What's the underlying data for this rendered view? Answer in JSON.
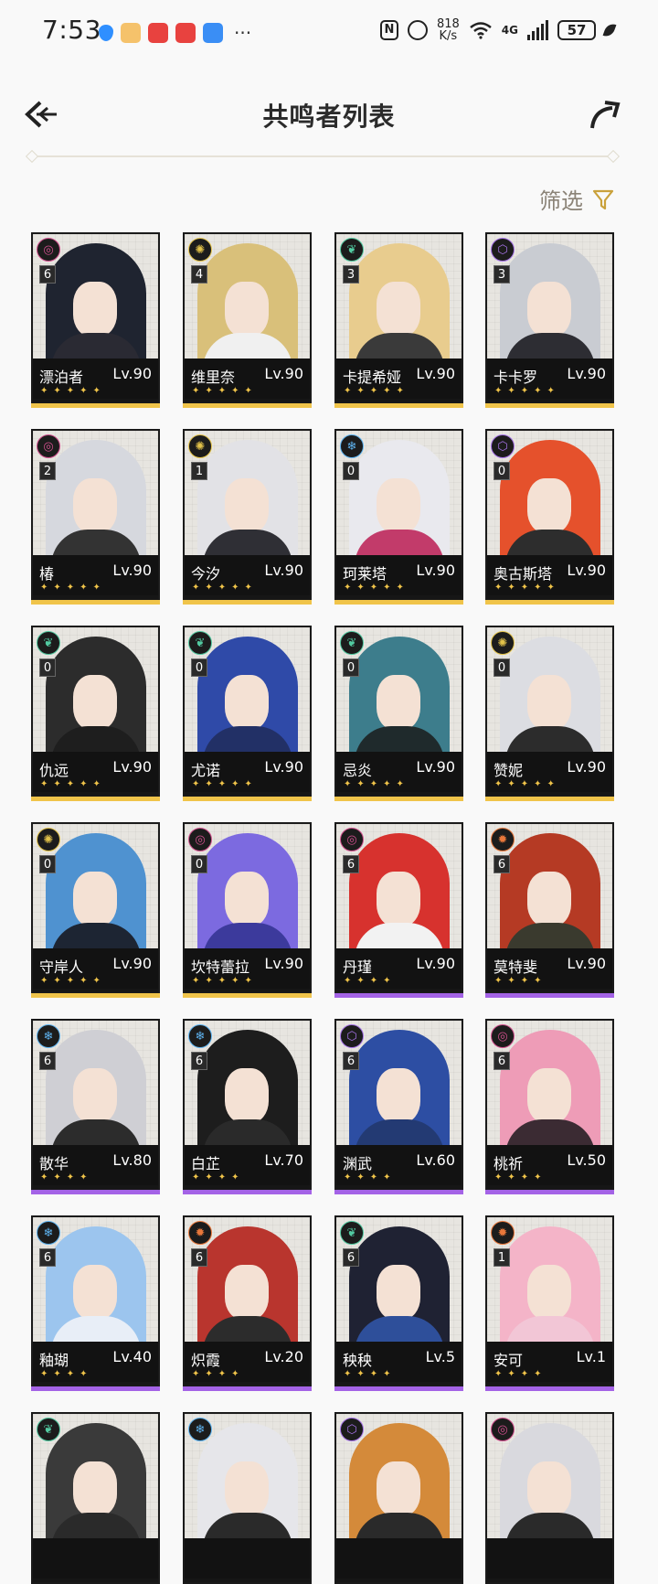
{
  "status_bar": {
    "time": "7:53",
    "net_speed_top": "818",
    "net_speed_bottom": "K/s",
    "battery": "57",
    "net_type": "4G",
    "nfc": "N"
  },
  "header": {
    "title": "共鸣者列表"
  },
  "filter": {
    "label": "筛选"
  },
  "colors": {
    "gold": "#f0c44a",
    "purple": "#a463e6",
    "title": "#2b2b2b",
    "filter": "#8b8377"
  },
  "characters": [
    {
      "name": "漂泊者",
      "level": "Lv.90",
      "rank": "6",
      "stars": 5,
      "element": "havoc",
      "hair": "#1f2430",
      "outfit": "#2a2a33"
    },
    {
      "name": "维里奈",
      "level": "Lv.90",
      "rank": "4",
      "stars": 5,
      "element": "spectro",
      "hair": "#d9c07a",
      "outfit": "#f0f0f0"
    },
    {
      "name": "卡提希娅",
      "level": "Lv.90",
      "rank": "3",
      "stars": 5,
      "element": "aero",
      "hair": "#e8cc8e",
      "outfit": "#3a3a3a"
    },
    {
      "name": "卡卡罗",
      "level": "Lv.90",
      "rank": "3",
      "stars": 5,
      "element": "electro",
      "hair": "#c9ccd2",
      "outfit": "#2d2d33"
    },
    {
      "name": "椿",
      "level": "Lv.90",
      "rank": "2",
      "stars": 5,
      "element": "havoc",
      "hair": "#d6d8de",
      "outfit": "#333"
    },
    {
      "name": "今汐",
      "level": "Lv.90",
      "rank": "1",
      "stars": 5,
      "element": "spectro",
      "hair": "#e2e2e6",
      "outfit": "#2f2f35"
    },
    {
      "name": "珂莱塔",
      "level": "Lv.90",
      "rank": "0",
      "stars": 5,
      "element": "glacio",
      "hair": "#e9e9ee",
      "outfit": "#c23b6a"
    },
    {
      "name": "奥古斯塔",
      "level": "Lv.90",
      "rank": "0",
      "stars": 5,
      "element": "electro",
      "hair": "#e5512c",
      "outfit": "#2d2d2d"
    },
    {
      "name": "仇远",
      "level": "Lv.90",
      "rank": "0",
      "stars": 5,
      "element": "aero",
      "hair": "#2c2c2c",
      "outfit": "#1e1e1e"
    },
    {
      "name": "尤诺",
      "level": "Lv.90",
      "rank": "0",
      "stars": 5,
      "element": "aero",
      "hair": "#2f4aa8",
      "outfit": "#223066"
    },
    {
      "name": "忌炎",
      "level": "Lv.90",
      "rank": "0",
      "stars": 5,
      "element": "aero",
      "hair": "#3d7d8c",
      "outfit": "#1f2a2c"
    },
    {
      "name": "赞妮",
      "level": "Lv.90",
      "rank": "0",
      "stars": 5,
      "element": "spectro",
      "hair": "#dcdde2",
      "outfit": "#2c2c2c"
    },
    {
      "name": "守岸人",
      "level": "Lv.90",
      "rank": "0",
      "stars": 5,
      "element": "spectro",
      "hair": "#4f92d0",
      "outfit": "#1d2533"
    },
    {
      "name": "坎特蕾拉",
      "level": "Lv.90",
      "rank": "0",
      "stars": 5,
      "element": "havoc",
      "hair": "#7c6ae0",
      "outfit": "#3c3a9c"
    },
    {
      "name": "丹瑾",
      "level": "Lv.90",
      "rank": "6",
      "stars": 4,
      "element": "havoc",
      "hair": "#d7322e",
      "outfit": "#f2f2f2"
    },
    {
      "name": "莫特斐",
      "level": "Lv.90",
      "rank": "6",
      "stars": 4,
      "element": "fusion",
      "hair": "#b53a24",
      "outfit": "#3a3a2e"
    },
    {
      "name": "散华",
      "level": "Lv.80",
      "rank": "6",
      "stars": 4,
      "element": "glacio",
      "hair": "#cfcfd4",
      "outfit": "#2c2c2c"
    },
    {
      "name": "白芷",
      "level": "Lv.70",
      "rank": "6",
      "stars": 4,
      "element": "glacio",
      "hair": "#1d1d1d",
      "outfit": "#2a2a2a"
    },
    {
      "name": "渊武",
      "level": "Lv.60",
      "rank": "6",
      "stars": 4,
      "element": "electro",
      "hair": "#2d4ea3",
      "outfit": "#233a73"
    },
    {
      "name": "桃祈",
      "level": "Lv.50",
      "rank": "6",
      "stars": 4,
      "element": "havoc",
      "hair": "#ee9cb7",
      "outfit": "#3b2b33"
    },
    {
      "name": "釉瑚",
      "level": "Lv.40",
      "rank": "6",
      "stars": 4,
      "element": "glacio",
      "hair": "#9cc5ee",
      "outfit": "#e8eef7"
    },
    {
      "name": "炽霞",
      "level": "Lv.20",
      "rank": "6",
      "stars": 4,
      "element": "fusion",
      "hair": "#b9352e",
      "outfit": "#2c2c2c"
    },
    {
      "name": "秧秧",
      "level": "Lv.5",
      "rank": "6",
      "stars": 4,
      "element": "aero",
      "hair": "#1f2233",
      "outfit": "#2e4f9a"
    },
    {
      "name": "安可",
      "level": "Lv.1",
      "rank": "1",
      "stars": 4,
      "element": "fusion",
      "hair": "#f4b4c8",
      "outfit": "#f2c6d6"
    },
    {
      "name": "",
      "level": "",
      "rank": "",
      "stars": 0,
      "element": "aero",
      "hair": "#3a3a3a",
      "outfit": "#2a2a2a"
    },
    {
      "name": "",
      "level": "",
      "rank": "",
      "stars": 0,
      "element": "glacio",
      "hair": "#e6e6ea",
      "outfit": "#2a2a2a"
    },
    {
      "name": "",
      "level": "",
      "rank": "",
      "stars": 0,
      "element": "electro",
      "hair": "#d48a3a",
      "outfit": "#2a2a2a"
    },
    {
      "name": "",
      "level": "",
      "rank": "",
      "stars": 0,
      "element": "havoc",
      "hair": "#d9d9de",
      "outfit": "#2a2a2a"
    }
  ]
}
